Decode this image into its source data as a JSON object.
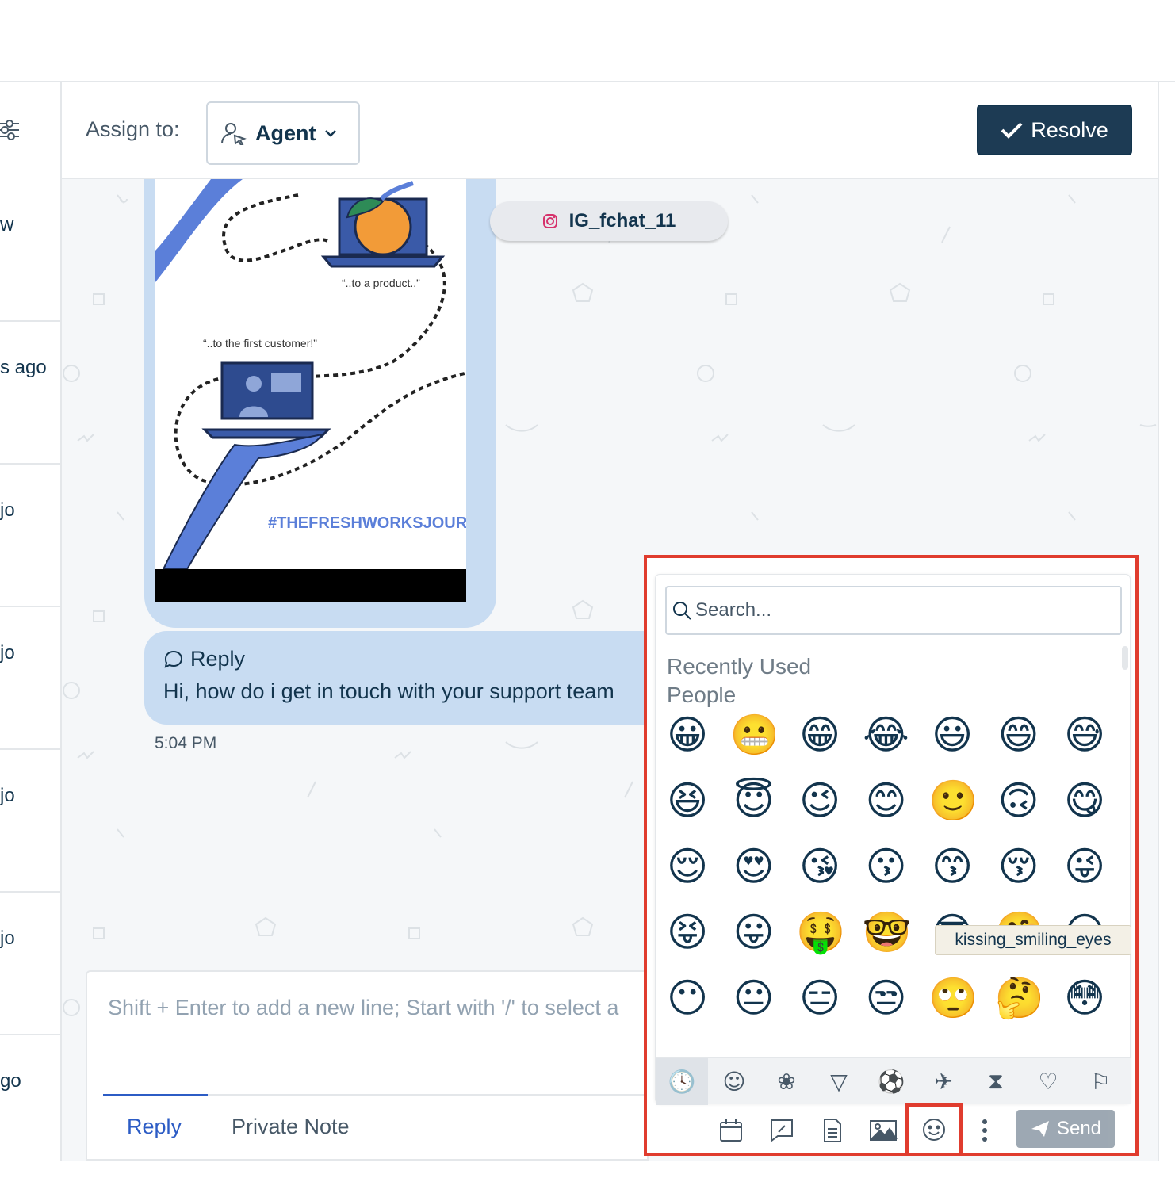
{
  "left_list": {
    "rows": [
      {
        "time": "w"
      },
      {
        "time": "s ago"
      },
      {
        "time": "jo"
      },
      {
        "time": "jo"
      },
      {
        "time": "jo"
      },
      {
        "time": "jo"
      },
      {
        "time": "go"
      }
    ]
  },
  "header": {
    "assign_label": "Assign to:",
    "agent_label": "Agent",
    "resolve_label": "Resolve"
  },
  "conversation": {
    "image_texts": {
      "product": "“..to a product..”",
      "customer": "“..to the first customer!”",
      "hashtag": "#THEFRESHWORKSJOURNEY"
    },
    "channel_name": "IG_fchat_11",
    "reply_label": "Reply",
    "reply_text": "Hi, how do i get in touch with your support team",
    "timestamp": "5:04 PM"
  },
  "composer": {
    "placeholder": "Shift + Enter to add a new line; Start with '/' to select a",
    "tabs": [
      {
        "label": "Reply",
        "active": true
      },
      {
        "label": "Private Note",
        "active": false
      }
    ]
  },
  "emoji_picker": {
    "search_placeholder": "Search...",
    "section_recent": "Recently Used",
    "section_people": "People",
    "emojis": [
      [
        "😀",
        "😬",
        "😁",
        "😂",
        "😃",
        "😄",
        "😅"
      ],
      [
        "😆",
        "😇",
        "😉",
        "😊",
        "🙂",
        "🙃",
        "😋"
      ],
      [
        "😌",
        "😍",
        "😘",
        "😗",
        "😙",
        "😚",
        "😜"
      ],
      [
        "😝",
        "😛",
        "🤑",
        "🤓",
        "😎",
        "🤗",
        "😏"
      ],
      [
        "😶",
        "😐",
        "😑",
        "😒",
        "🙄",
        "🤔",
        "😳"
      ]
    ],
    "tooltip": "kissing_smiling_eyes",
    "categories": [
      "clock-icon",
      "smiley-icon",
      "animal-icon",
      "food-icon",
      "sports-icon",
      "travel-icon",
      "objects-icon",
      "heart-icon",
      "flag-icon"
    ]
  },
  "toolbar": {
    "send_label": "Send"
  },
  "colors": {
    "accent": "#2c5cc5",
    "resolve_bg": "#1d3b54",
    "highlight": "#e03c2e",
    "bubble": "#c8dcf2"
  }
}
